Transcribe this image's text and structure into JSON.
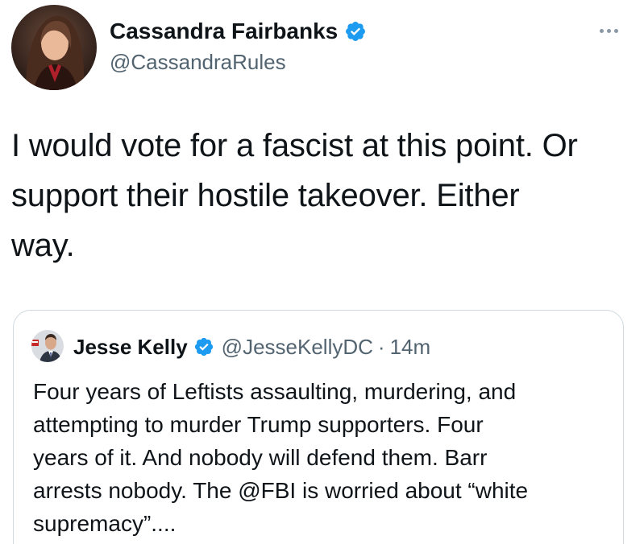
{
  "tweet": {
    "author": {
      "name": "Cassandra Fairbanks",
      "handle": "@CassandraRules",
      "verified": true,
      "avatar": "profile-photo"
    },
    "more_icon": "more-horizontal-icon",
    "text_lines": [
      "I would vote for a fascist at this point. Or",
      "support their hostile takeover. Either",
      "way."
    ]
  },
  "quoted_tweet": {
    "author": {
      "name": "Jesse Kelly",
      "handle": "@JesseKellyDC",
      "verified": true,
      "avatar": "profile-photo"
    },
    "separator": "·",
    "time": "14m",
    "text_lines": [
      "Four years of Leftists assaulting, murdering, and",
      "attempting to murder Trump supporters. Four",
      "years of it. And nobody will defend them. Barr",
      "arrests nobody. The @FBI is worried about “white",
      "supremacy”...."
    ]
  },
  "colors": {
    "verified_blue": "#1d9bf0",
    "text_primary": "#0f1419",
    "text_secondary": "#536471",
    "border": "#cfd9de"
  }
}
